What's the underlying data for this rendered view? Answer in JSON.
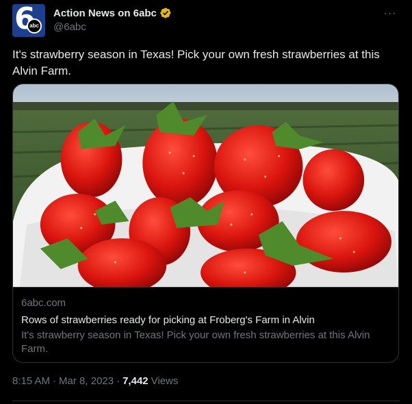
{
  "author": {
    "display_name": "Action News on 6abc",
    "handle": "@6abc",
    "avatar_number": "6",
    "avatar_logo": "abc",
    "verified_badge": "verified-gold-badge-icon"
  },
  "menu": {
    "more_glyph": "···"
  },
  "tweet": {
    "text": "It's strawberry season in Texas! Pick your own fresh strawberries at this Alvin Farm."
  },
  "card": {
    "image_icon": "strawberries-in-bucket-photo",
    "domain": "6abc.com",
    "title": "Rows of strawberries ready for picking at Froberg's Farm in Alvin",
    "description": "It's strawberry season in Texas! Pick your own fresh strawberries at this Alvin Farm."
  },
  "meta": {
    "time": "8:15 AM",
    "separator": "·",
    "date": "Mar 8, 2023",
    "views_count": "7,442",
    "views_label": "Views"
  },
  "colors": {
    "background": "#000000",
    "text_primary": "#e7e9ea",
    "text_secondary": "#71767b",
    "border": "#2f3336",
    "verified_gold": "#e2b719",
    "avatar_blue": "#1d3f8f"
  }
}
